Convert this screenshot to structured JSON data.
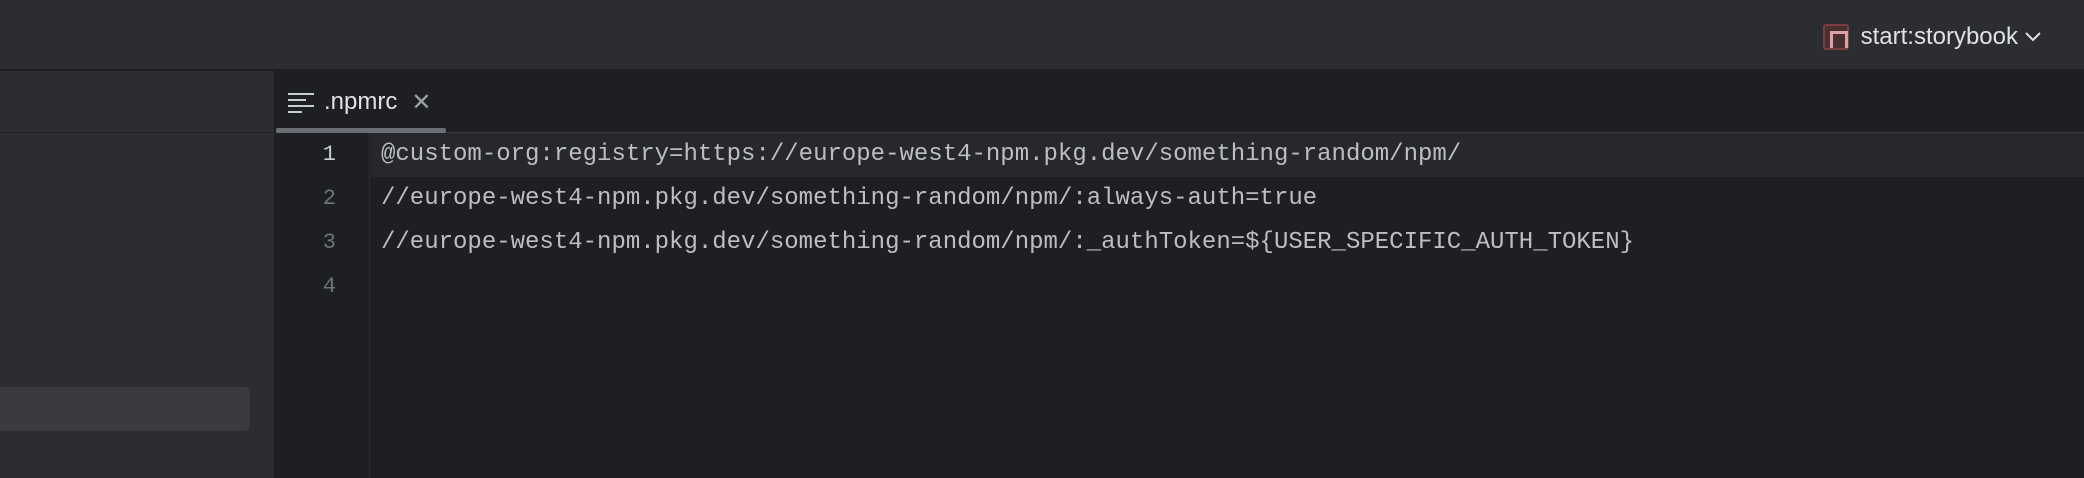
{
  "toolbar": {
    "run_config_label": "start:storybook",
    "run_config_icon": "npm-icon",
    "dropdown_icon": "chevron-down-icon"
  },
  "tabs": [
    {
      "label": ".npmrc",
      "icon": "text-file-icon",
      "close_glyph": "✕",
      "active": true
    }
  ],
  "editor": {
    "current_line": 1,
    "lines": [
      {
        "number": "1",
        "text": "@custom-org:registry=https://europe-west4-npm.pkg.dev/something-random/npm/"
      },
      {
        "number": "2",
        "text": "//europe-west4-npm.pkg.dev/something-random/npm/:always-auth=true"
      },
      {
        "number": "3",
        "text": "//europe-west4-npm.pkg.dev/something-random/npm/:_authToken=${USER_SPECIFIC_AUTH_TOKEN}"
      },
      {
        "number": "4",
        "text": ""
      }
    ]
  },
  "colors": {
    "background": "#1e1f22",
    "panel": "#2b2d30",
    "text": "#bcbec4",
    "line_number": "#6f737a"
  }
}
